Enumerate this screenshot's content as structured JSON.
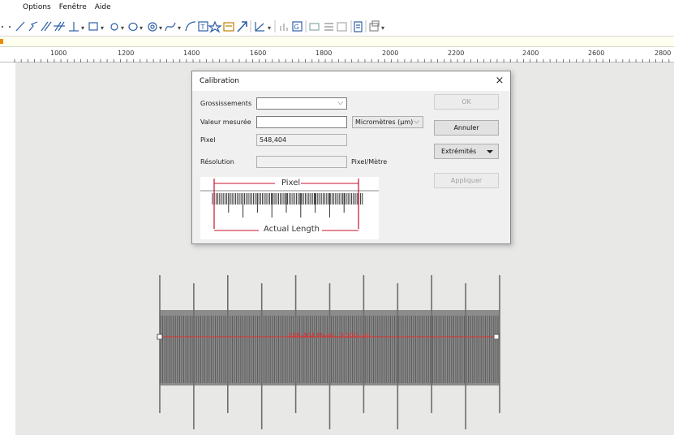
{
  "menu": [
    "Options",
    "Fenêtre",
    "Aide"
  ],
  "toolbar": {
    "icons": [
      "dot-icon",
      "line-icon",
      "polyline-icon",
      "parallel-icon",
      "double-parallel-icon",
      "perpendicular-icon",
      "rectangle-icon",
      "circle-icon",
      "ellipse-icon",
      "concentric-icon",
      "curve-icon",
      "arc-icon",
      "text-icon",
      "star-icon",
      "scale-bar-icon",
      "arrow-icon",
      "angle-icon",
      "chart-icon",
      "calibration-icon",
      "export-icon",
      "align-icon",
      "layout-icon",
      "notes-icon",
      "window-icon"
    ]
  },
  "ruler": {
    "labels": [
      "1000",
      "1200",
      "1400",
      "1600",
      "1800",
      "2000",
      "2200",
      "2400",
      "2600",
      "2800"
    ]
  },
  "measurement": {
    "label": "548,404 Pixels, 0,000 µm"
  },
  "dialog": {
    "title": "Calibration",
    "close": "×",
    "magnification_label": "Grossissements",
    "magnification_value": "",
    "measured_value_label": "Valeur mesurée",
    "measured_value": "",
    "unit_value": "Micromètres (µm)",
    "pixel_label": "Pixel",
    "pixel_value": "548,404",
    "resolution_label": "Résolution",
    "resolution_value": "",
    "resolution_unit": "Pixel/Mètre",
    "ok_label": "OK",
    "cancel_label": "Annuler",
    "endpoints_label": "Extrémités",
    "apply_label": "Appliquer",
    "diagram_pixel_label": "Pixel",
    "diagram_actual_label": "Actual Length"
  },
  "colors": {
    "accent_red": "#e03030",
    "diagram_red": "#c8102e",
    "orange_marker": "#e88b00"
  }
}
